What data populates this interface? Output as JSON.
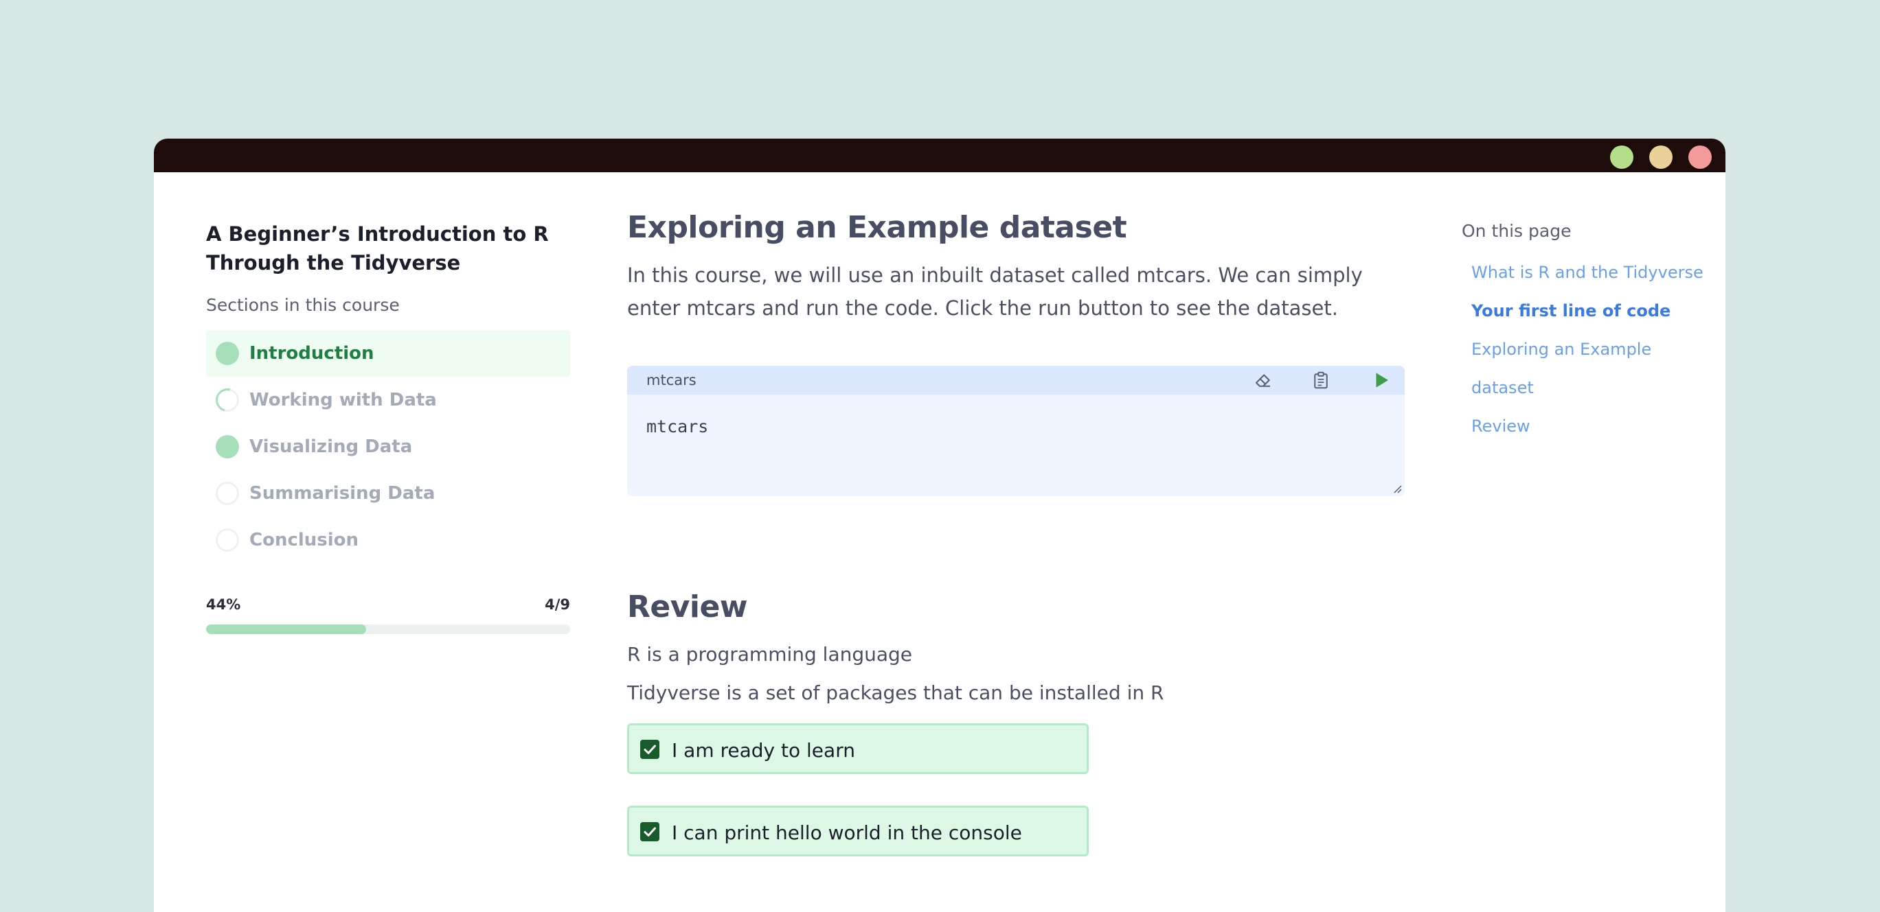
{
  "colors": {
    "background": "#d7e7e3",
    "titlebar": "#1e0c0a",
    "accent_green": "#a8dfbb",
    "active_text": "#1f7f43",
    "link_blue": "#6aa0e8"
  },
  "window": {
    "controls": [
      "green-dot",
      "yellow-dot",
      "red-dot"
    ]
  },
  "sidebar": {
    "course_title": "A Beginner’s Introduction to R Through the Tidyverse",
    "sections_label": "Sections in this course",
    "items": [
      {
        "label": "Introduction",
        "status": "complete",
        "active": true
      },
      {
        "label": "Working with Data",
        "status": "in-progress",
        "active": false
      },
      {
        "label": "Visualizing Data",
        "status": "complete",
        "active": false
      },
      {
        "label": "Summarising Data",
        "status": "not-started",
        "active": false
      },
      {
        "label": "Conclusion",
        "status": "not-started",
        "active": false
      }
    ],
    "progress": {
      "percent_label": "44%",
      "count_label": "4/9",
      "fraction": 0.44
    }
  },
  "main": {
    "explore": {
      "title": "Exploring an Example dataset",
      "paragraph": "In this course, we will use an inbuilt dataset called mtcars. We can simply enter mtcars and run the code. Click the run button to see the dataset."
    },
    "code_editor": {
      "filename": "mtcars",
      "code": "mtcars",
      "icons": [
        "eraser-icon",
        "clipboard-icon",
        "play-icon"
      ]
    },
    "review": {
      "title": "Review",
      "lines": [
        "R is a programming language",
        "Tidyverse is a set of packages that can be installed in R"
      ],
      "checks": [
        {
          "label": "I am ready to learn",
          "checked": true
        },
        {
          "label": "I can print hello world in the console",
          "checked": true
        }
      ]
    }
  },
  "toc": {
    "title": "On this page",
    "links": [
      {
        "label": "What is R and the Tidyverse",
        "active": false
      },
      {
        "label": "Your first line of code",
        "active": true
      },
      {
        "label": "Exploring an Example dataset",
        "active": false
      },
      {
        "label": "Review",
        "active": false
      }
    ]
  }
}
